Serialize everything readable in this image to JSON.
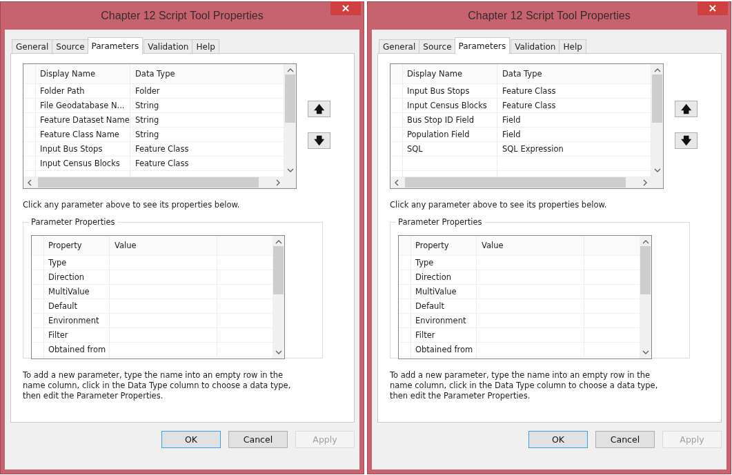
{
  "dialogs": [
    {
      "title": "Chapter 12 Script Tool Properties",
      "close": "×",
      "tabs": [
        {
          "label": "General",
          "selected": false
        },
        {
          "label": "Source",
          "selected": false
        },
        {
          "label": "Parameters",
          "selected": true
        },
        {
          "label": "Validation",
          "selected": false
        },
        {
          "label": "Help",
          "selected": false
        }
      ],
      "parameters": {
        "columns": [
          "Display Name",
          "Data Type"
        ],
        "rows": [
          {
            "name": "Folder Path",
            "type": "Folder"
          },
          {
            "name": "File Geodatabase N...",
            "type": "String"
          },
          {
            "name": "Feature Dataset Name",
            "type": "String"
          },
          {
            "name": "Feature Class Name",
            "type": "String"
          },
          {
            "name": "Input Bus Stops",
            "type": "Feature Class"
          },
          {
            "name": "Input Census Blocks",
            "type": "Feature Class"
          }
        ]
      },
      "move_up": "🡅",
      "move_down": "🡇",
      "hint": "Click any parameter above to see its properties below.",
      "properties_group": {
        "title": "Parameter Properties",
        "columns": [
          "Property",
          "Value"
        ],
        "rows": [
          "Type",
          "Direction",
          "MultiValue",
          "Default",
          "Environment",
          "Filter",
          "Obtained from"
        ]
      },
      "help": "To add a new parameter, type the name into an empty row in the name column, click in the Data Type column to choose a data type, then edit the Parameter Properties.",
      "buttons": [
        {
          "label": "OK",
          "default": true,
          "disabled": false
        },
        {
          "label": "Cancel",
          "default": false,
          "disabled": false
        },
        {
          "label": "Apply",
          "default": false,
          "disabled": true
        }
      ]
    },
    {
      "title": "Chapter 12 Script Tool Properties",
      "close": "×",
      "tabs": [
        {
          "label": "General",
          "selected": false
        },
        {
          "label": "Source",
          "selected": false
        },
        {
          "label": "Parameters",
          "selected": true
        },
        {
          "label": "Validation",
          "selected": false
        },
        {
          "label": "Help",
          "selected": false
        }
      ],
      "parameters": {
        "columns": [
          "Display Name",
          "Data Type"
        ],
        "rows": [
          {
            "name": "Input Bus Stops",
            "type": "Feature Class"
          },
          {
            "name": "Input Census Blocks",
            "type": "Feature Class"
          },
          {
            "name": "Bus Stop ID Field",
            "type": "Field"
          },
          {
            "name": "Population Field",
            "type": "Field"
          },
          {
            "name": "SQL",
            "type": "SQL Expression"
          }
        ]
      },
      "move_up": "🡅",
      "move_down": "🡇",
      "hint": "Click any parameter above to see its properties below.",
      "properties_group": {
        "title": "Parameter Properties",
        "columns": [
          "Property",
          "Value"
        ],
        "rows": [
          "Type",
          "Direction",
          "MultiValue",
          "Default",
          "Environment",
          "Filter",
          "Obtained from"
        ]
      },
      "help": "To add a new parameter, type the name into an empty row in the name column, click in the Data Type column to choose a data type, then edit the Parameter Properties.",
      "buttons": [
        {
          "label": "OK",
          "default": true,
          "disabled": false
        },
        {
          "label": "Cancel",
          "default": false,
          "disabled": false
        },
        {
          "label": "Apply",
          "default": false,
          "disabled": true
        }
      ]
    }
  ]
}
